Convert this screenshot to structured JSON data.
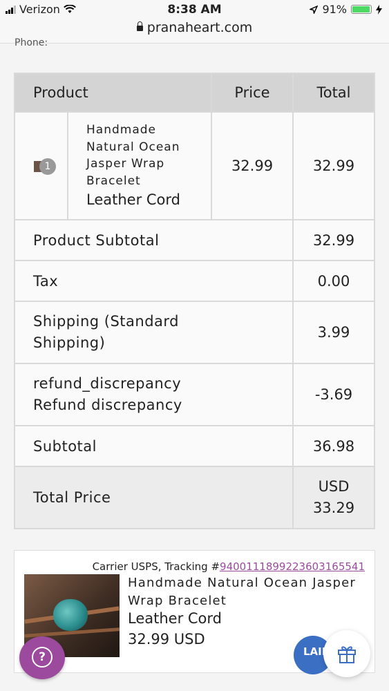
{
  "status_bar": {
    "carrier": "Verizon",
    "time": "8:38 AM",
    "battery": "91%"
  },
  "browser": {
    "url": "pranaheart.com"
  },
  "top_label": "Phone:",
  "order_table": {
    "headers": {
      "product": "Product",
      "price": "Price",
      "total": "Total"
    },
    "item": {
      "quantity": "1",
      "title": "Handmade Natural Ocean Jasper Wrap Bracelet",
      "variant": "Leather Cord",
      "price": "32.99",
      "total": "32.99"
    },
    "rows": {
      "product_subtotal": {
        "label": "Product Subtotal",
        "value": "32.99"
      },
      "tax": {
        "label": "Tax",
        "value": "0.00"
      },
      "shipping": {
        "label": "Shipping (Standard Shipping)",
        "value": "3.99"
      },
      "refund_line1": "refund_discrepancy",
      "refund_line2": "Refund discrepancy",
      "refund_value": "-3.69",
      "subtotal": {
        "label": "Subtotal",
        "value": "36.98"
      },
      "total_label": "Total Price",
      "total_currency": "USD",
      "total_value": "33.29"
    }
  },
  "fulfillment": {
    "tracking_prefix": "Carrier USPS, Tracking #",
    "tracking_number": "9400111899223603165541",
    "title": "Handmade Natural Ocean Jasper Wrap Bracelet",
    "variant": "Leather Cord",
    "price": "32.99 USD"
  },
  "floating": {
    "help_symbol": "?",
    "badge_text": "LAIN",
    "help_icon": "question-icon",
    "gift_icon": "gift-icon"
  },
  "colors": {
    "accent_purple": "#9b4a9e",
    "header_gray": "#d4d4d4",
    "badge_blue": "#3a6fc4"
  }
}
